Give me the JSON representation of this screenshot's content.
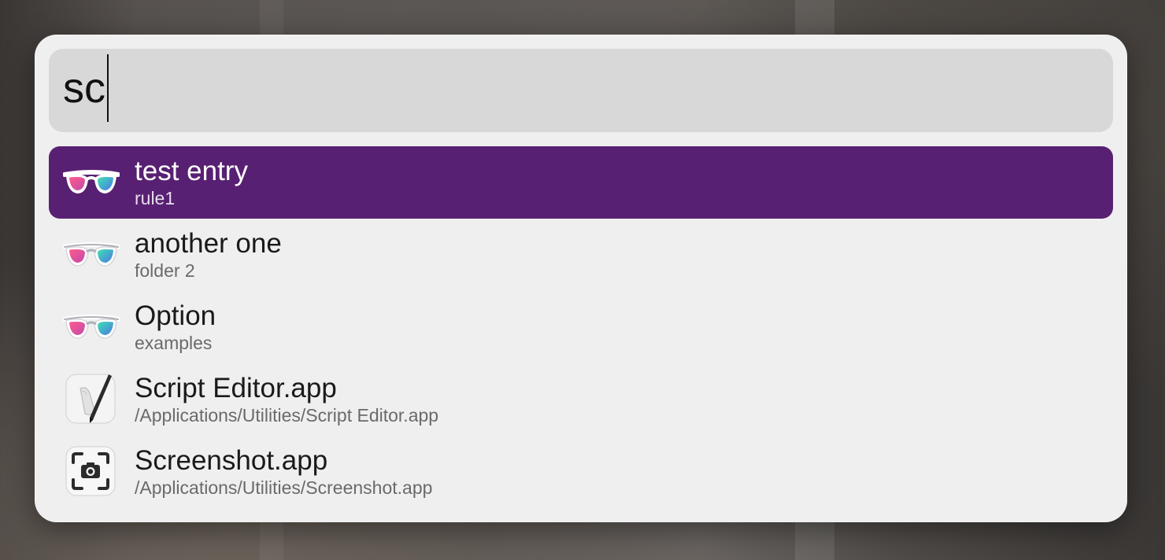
{
  "search": {
    "query": "sc"
  },
  "results": [
    {
      "title": "test entry",
      "subtitle": "rule1",
      "icon": "sunglasses-icon",
      "selected": true
    },
    {
      "title": "another one",
      "subtitle": "folder 2",
      "icon": "sunglasses-icon",
      "selected": false
    },
    {
      "title": "Option",
      "subtitle": "examples",
      "icon": "sunglasses-icon",
      "selected": false
    },
    {
      "title": "Script Editor.app",
      "subtitle": "/Applications/Utilities/Script Editor.app",
      "icon": "script-editor-icon",
      "selected": false
    },
    {
      "title": "Screenshot.app",
      "subtitle": "/Applications/Utilities/Screenshot.app",
      "icon": "screenshot-icon",
      "selected": false
    }
  ],
  "colors": {
    "selection": "#582072",
    "panel": "#efefef",
    "search_field": "#d8d8d8"
  }
}
